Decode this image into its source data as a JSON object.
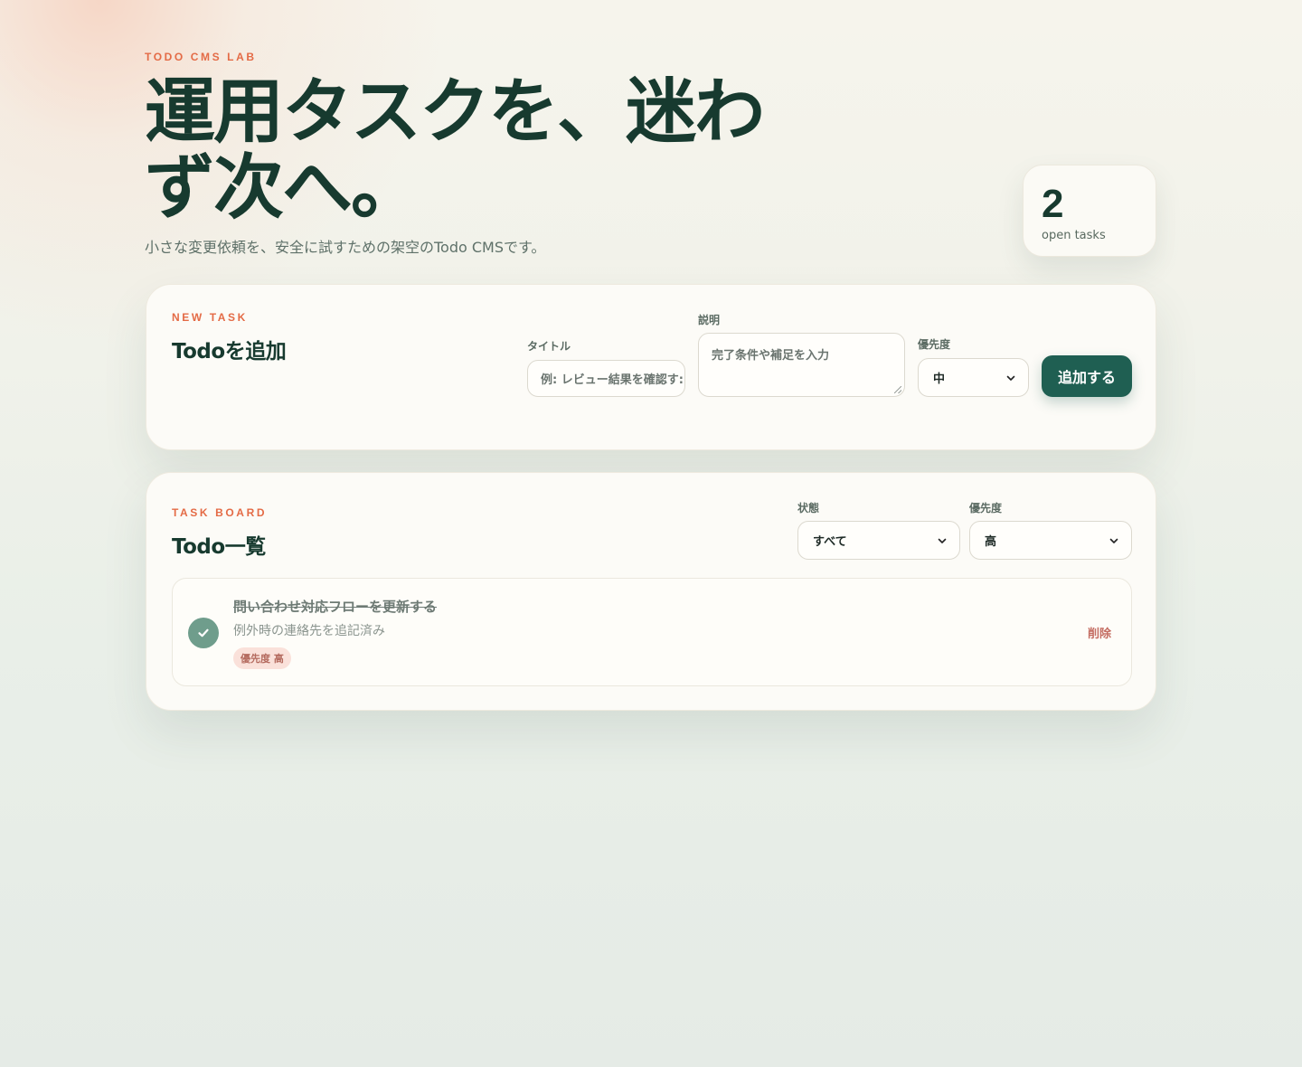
{
  "hero": {
    "eyebrow": "TODO CMS LAB",
    "title": "運用タスクを、迷わず次へ。",
    "subtitle": "小さな変更依頼を、安全に試すための架空のTodo CMSです。"
  },
  "stats": {
    "open_count": "2",
    "open_label": "open tasks"
  },
  "new_task": {
    "eyebrow": "NEW TASK",
    "title": "Todoを追加",
    "title_field": {
      "label": "タイトル",
      "placeholder": "例: レビュー結果を確認す:"
    },
    "description_field": {
      "label": "説明",
      "placeholder": "完了条件や補足を入力"
    },
    "priority_field": {
      "label": "優先度",
      "value": "中"
    },
    "submit_label": "追加する"
  },
  "board": {
    "eyebrow": "TASK BOARD",
    "title": "Todo一覧",
    "filters": {
      "status": {
        "label": "状態",
        "value": "すべて"
      },
      "priority": {
        "label": "優先度",
        "value": "高"
      }
    },
    "tasks": [
      {
        "title": "問い合わせ対応フローを更新する",
        "description": "例外時の連絡先を追記済み",
        "badge": "優先度 高",
        "completed": true,
        "delete_label": "削除"
      }
    ]
  },
  "colors": {
    "accent": "#e46b46",
    "primary": "#1f5f52",
    "text": "#173a2f",
    "check": "#6f9d8c",
    "danger": "#c46d62",
    "badge_bg": "#fae1da"
  },
  "icons": {
    "check": "check-icon",
    "dropdown": "chevron-down-icon",
    "resize": "resize-handle-icon"
  }
}
